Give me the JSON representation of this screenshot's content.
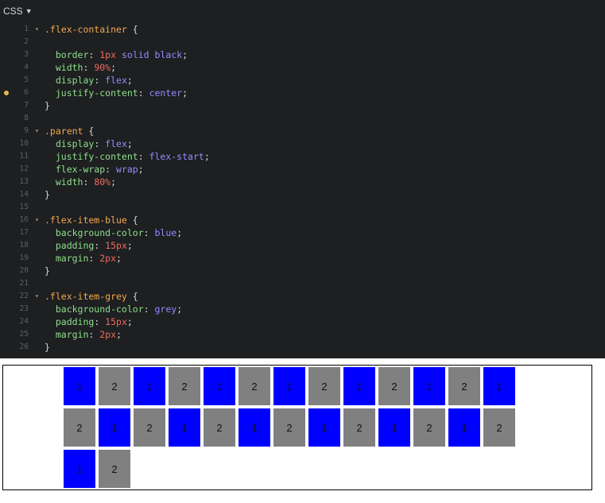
{
  "panel": {
    "title": "CSS",
    "toggle_icon": "triangle-down-icon"
  },
  "lines": [
    {
      "n": "1",
      "fold": true,
      "tokens": [
        [
          "sel",
          ".flex-container"
        ],
        [
          "punc",
          " {"
        ]
      ]
    },
    {
      "n": "2",
      "tokens": []
    },
    {
      "n": "3",
      "tokens": [
        [
          "prop",
          "  border"
        ],
        [
          "punc",
          ": "
        ],
        [
          "num-v",
          "1px"
        ],
        [
          "punc",
          " "
        ],
        [
          "kw",
          "solid"
        ],
        [
          "punc",
          " "
        ],
        [
          "kw",
          "black"
        ],
        [
          "punc",
          ";"
        ]
      ]
    },
    {
      "n": "4",
      "tokens": [
        [
          "prop",
          "  width"
        ],
        [
          "punc",
          ": "
        ],
        [
          "num-v",
          "90%"
        ],
        [
          "punc",
          ";"
        ]
      ]
    },
    {
      "n": "5",
      "tokens": [
        [
          "prop",
          "  display"
        ],
        [
          "punc",
          ": "
        ],
        [
          "kw",
          "flex"
        ],
        [
          "punc",
          ";"
        ]
      ]
    },
    {
      "n": "6",
      "dot": true,
      "tokens": [
        [
          "prop",
          "  justify-content"
        ],
        [
          "punc",
          ": "
        ],
        [
          "kw",
          "center"
        ],
        [
          "punc",
          ";"
        ]
      ]
    },
    {
      "n": "7",
      "tokens": [
        [
          "punc",
          "}"
        ]
      ]
    },
    {
      "n": "8",
      "tokens": []
    },
    {
      "n": "9",
      "fold": true,
      "tokens": [
        [
          "sel",
          ".parent"
        ],
        [
          "punc",
          " {"
        ]
      ]
    },
    {
      "n": "10",
      "tokens": [
        [
          "prop",
          "  display"
        ],
        [
          "punc",
          ": "
        ],
        [
          "kw",
          "flex"
        ],
        [
          "punc",
          ";"
        ]
      ]
    },
    {
      "n": "11",
      "tokens": [
        [
          "prop",
          "  justify-content"
        ],
        [
          "punc",
          ": "
        ],
        [
          "kw",
          "flex-start"
        ],
        [
          "punc",
          ";"
        ]
      ]
    },
    {
      "n": "12",
      "tokens": [
        [
          "prop",
          "  flex-wrap"
        ],
        [
          "punc",
          ": "
        ],
        [
          "kw",
          "wrap"
        ],
        [
          "punc",
          ";"
        ]
      ]
    },
    {
      "n": "13",
      "tokens": [
        [
          "prop",
          "  width"
        ],
        [
          "punc",
          ": "
        ],
        [
          "num-v",
          "80%"
        ],
        [
          "punc",
          ";"
        ]
      ]
    },
    {
      "n": "14",
      "tokens": [
        [
          "punc",
          "}"
        ]
      ]
    },
    {
      "n": "15",
      "tokens": []
    },
    {
      "n": "16",
      "fold": true,
      "tokens": [
        [
          "sel",
          ".flex-item-blue"
        ],
        [
          "punc",
          " {"
        ]
      ]
    },
    {
      "n": "17",
      "tokens": [
        [
          "prop",
          "  background-color"
        ],
        [
          "punc",
          ": "
        ],
        [
          "kw",
          "blue"
        ],
        [
          "punc",
          ";"
        ]
      ]
    },
    {
      "n": "18",
      "tokens": [
        [
          "prop",
          "  padding"
        ],
        [
          "punc",
          ": "
        ],
        [
          "num-v",
          "15px"
        ],
        [
          "punc",
          ";"
        ]
      ]
    },
    {
      "n": "19",
      "tokens": [
        [
          "prop",
          "  margin"
        ],
        [
          "punc",
          ": "
        ],
        [
          "num-v",
          "2px"
        ],
        [
          "punc",
          ";"
        ]
      ]
    },
    {
      "n": "20",
      "tokens": [
        [
          "punc",
          "}"
        ]
      ]
    },
    {
      "n": "21",
      "tokens": []
    },
    {
      "n": "22",
      "fold": true,
      "tokens": [
        [
          "sel",
          ".flex-item-grey"
        ],
        [
          "punc",
          " {"
        ]
      ]
    },
    {
      "n": "23",
      "tokens": [
        [
          "prop",
          "  background-color"
        ],
        [
          "punc",
          ": "
        ],
        [
          "kw",
          "grey"
        ],
        [
          "punc",
          ";"
        ]
      ]
    },
    {
      "n": "24",
      "tokens": [
        [
          "prop",
          "  padding"
        ],
        [
          "punc",
          ": "
        ],
        [
          "num-v",
          "15px"
        ],
        [
          "punc",
          ";"
        ]
      ]
    },
    {
      "n": "25",
      "tokens": [
        [
          "prop",
          "  margin"
        ],
        [
          "punc",
          ": "
        ],
        [
          "num-v",
          "2px"
        ],
        [
          "punc",
          ";"
        ]
      ]
    },
    {
      "n": "26",
      "tokens": [
        [
          "punc",
          "}"
        ]
      ]
    }
  ],
  "preview": {
    "items": [
      {
        "color": "blue",
        "label": "1"
      },
      {
        "color": "grey",
        "label": "2"
      },
      {
        "color": "blue",
        "label": "1"
      },
      {
        "color": "grey",
        "label": "2"
      },
      {
        "color": "blue",
        "label": "1"
      },
      {
        "color": "grey",
        "label": "2"
      },
      {
        "color": "blue",
        "label": "1"
      },
      {
        "color": "grey",
        "label": "2"
      },
      {
        "color": "blue",
        "label": "1"
      },
      {
        "color": "grey",
        "label": "2"
      },
      {
        "color": "blue",
        "label": "1"
      },
      {
        "color": "grey",
        "label": "2"
      },
      {
        "color": "blue",
        "label": "1"
      },
      {
        "color": "grey",
        "label": "2"
      },
      {
        "color": "blue",
        "label": "1"
      },
      {
        "color": "grey",
        "label": "2"
      },
      {
        "color": "blue",
        "label": "1"
      },
      {
        "color": "grey",
        "label": "2"
      },
      {
        "color": "blue",
        "label": "1"
      },
      {
        "color": "grey",
        "label": "2"
      },
      {
        "color": "blue",
        "label": "1"
      },
      {
        "color": "grey",
        "label": "2"
      },
      {
        "color": "blue",
        "label": "1"
      },
      {
        "color": "grey",
        "label": "2"
      },
      {
        "color": "blue",
        "label": "1"
      },
      {
        "color": "grey",
        "label": "2"
      },
      {
        "color": "blue",
        "label": "1"
      },
      {
        "color": "grey",
        "label": "2"
      }
    ]
  },
  "colors": {
    "editor_bg": "#1d1f21",
    "blue": "#0000ff",
    "grey": "#808080",
    "modified_dot": "#e8b74d"
  }
}
